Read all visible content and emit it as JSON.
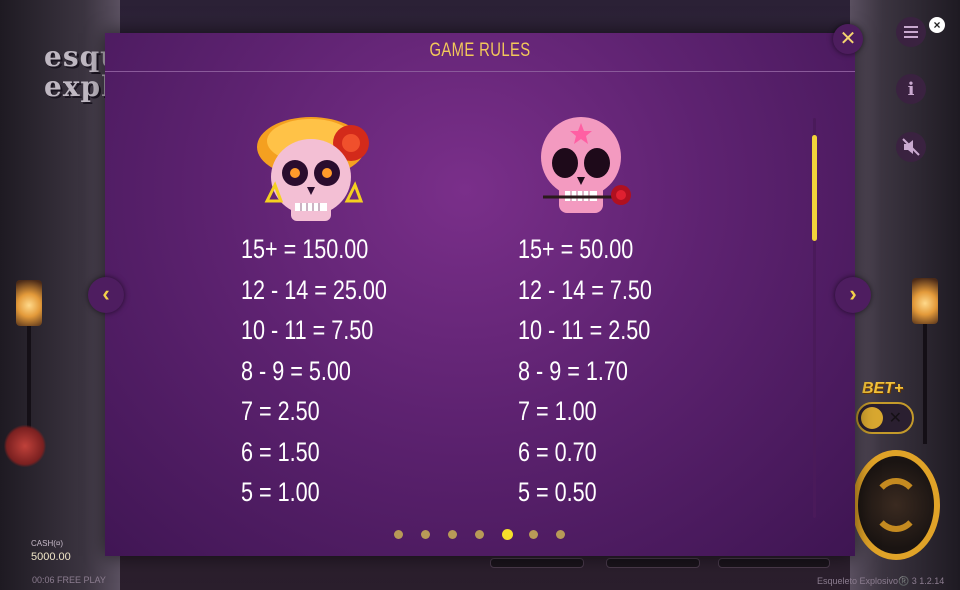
{
  "game": {
    "logo_lines": [
      "esqu",
      "expl"
    ],
    "cash_label": "CASH(¤)",
    "cash_value": "5000.00",
    "free_play_text": "00:06 FREE PLAY",
    "version_text": "Esqueleto Explosivo®️ 3  1.2.14",
    "betplus_label": "BET+",
    "toggle_state_symbol": "✕"
  },
  "controls": {
    "menu_icon": "hamburger-menu-icon",
    "info_icon": "info-icon",
    "sound_icon": "sound-muted-icon"
  },
  "modal": {
    "title": "GAME RULES",
    "close_symbol": "✕",
    "prev_symbol": "‹",
    "next_symbol": "›",
    "page_count": 7,
    "active_page_index": 4,
    "paytables": [
      {
        "symbol_icon": "orange-headdress-skull-icon",
        "lines": [
          "15+ = 150.00",
          "12 - 14 = 25.00",
          "10 - 11 = 7.50",
          "8 - 9 = 5.00",
          "7 = 2.50",
          "6 = 1.50",
          "5 = 1.00"
        ]
      },
      {
        "symbol_icon": "pink-rose-skull-icon",
        "lines": [
          "15+ = 50.00",
          "12 - 14 = 7.50",
          "10 - 11 = 2.50",
          "8 - 9 = 1.70",
          "7 = 1.00",
          "6 = 0.70",
          "5 = 0.50"
        ]
      }
    ]
  },
  "colors": {
    "accent_gold": "#f3c85a",
    "modal_purple": "#5d2270",
    "active_dot": "#f5e02a",
    "inactive_dot": "#b89a57"
  }
}
